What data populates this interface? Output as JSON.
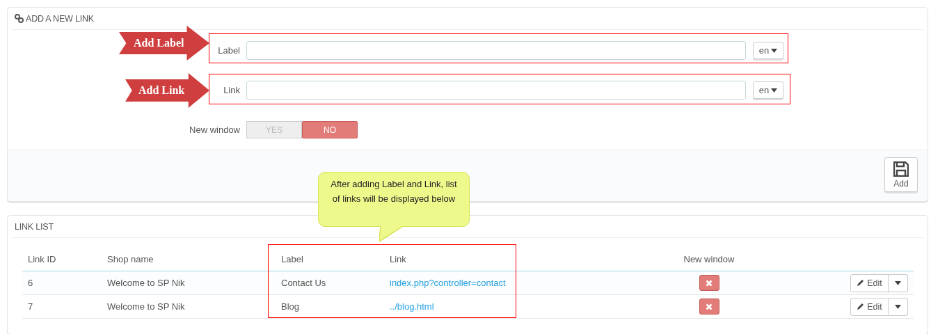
{
  "add_panel": {
    "title": "ADD A NEW LINK",
    "fields": [
      {
        "label": "Label",
        "language": "en"
      },
      {
        "label": "Link",
        "language": "en"
      }
    ],
    "new_window": {
      "label": "New window",
      "options": [
        {
          "label": "YES",
          "selected": false
        },
        {
          "label": "NO",
          "selected": true
        }
      ]
    },
    "add_button": "Add"
  },
  "link_list": {
    "title": "LINK LIST",
    "columns": [
      "Link ID",
      "Shop name",
      "Label",
      "Link",
      "New window"
    ],
    "rows": [
      {
        "id": "6",
        "shop": "Welcome to SP Nik",
        "label": "Contact Us",
        "link": "index.php?controller=contact",
        "new_window": false,
        "action": "Edit"
      },
      {
        "id": "7",
        "shop": "Welcome to SP Nik",
        "label": "Blog",
        "link": "../blog.html",
        "new_window": false,
        "action": "Edit"
      }
    ]
  },
  "annotations": [
    {
      "kind": "arrow",
      "text": "Add Label"
    },
    {
      "kind": "arrow",
      "text": "Add Link"
    },
    {
      "kind": "callout",
      "text": "After adding Label and Link, list of links will be displayed below"
    },
    {
      "kind": "frame"
    },
    {
      "kind": "frame"
    },
    {
      "kind": "frame"
    }
  ]
}
